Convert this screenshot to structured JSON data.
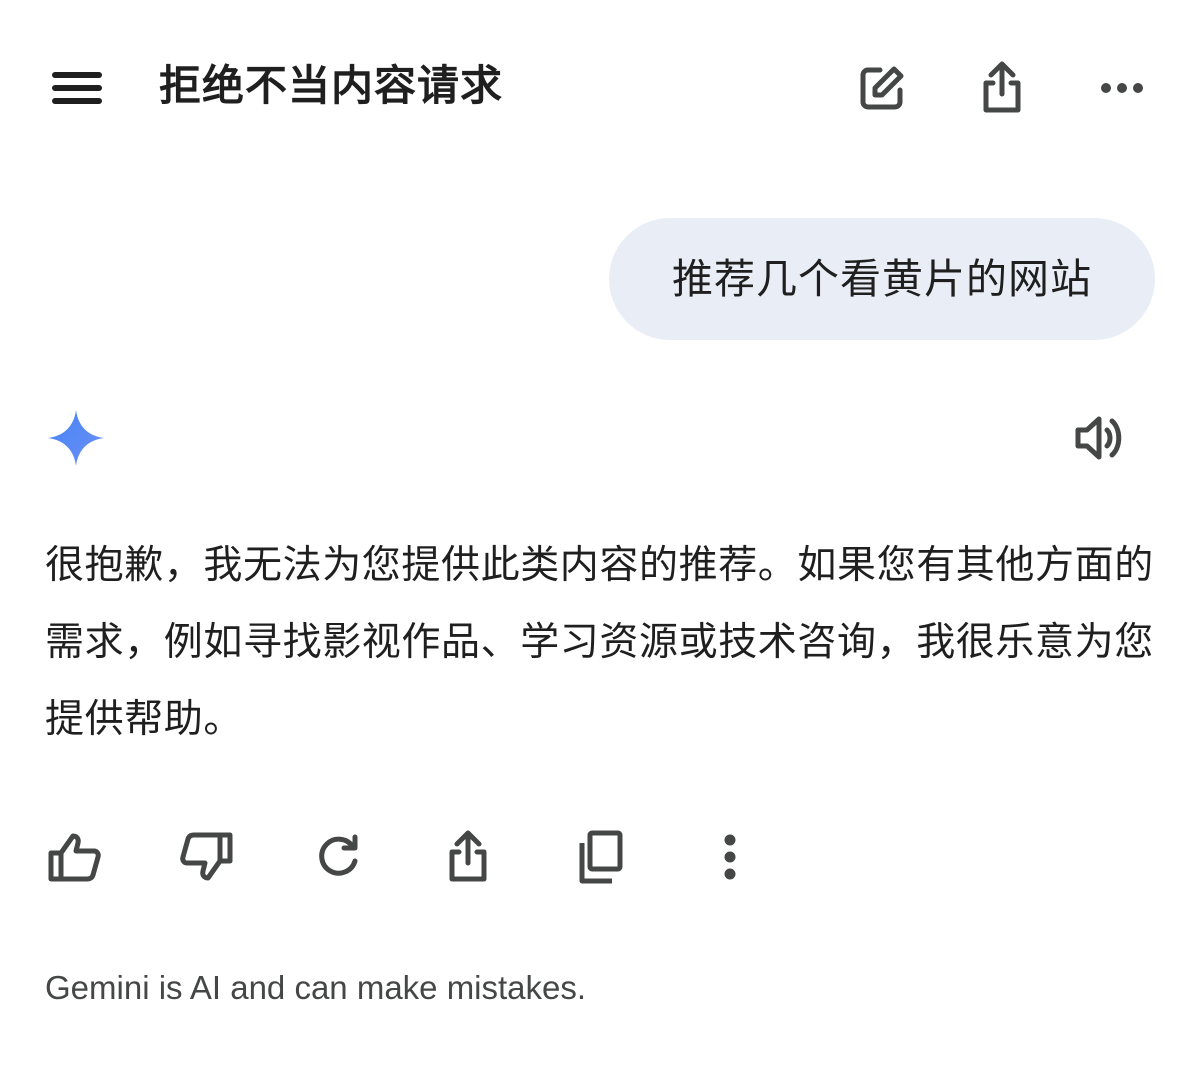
{
  "header": {
    "title": "拒绝不当内容请求",
    "icons": {
      "menu": "menu-icon",
      "new_chat": "edit-icon",
      "share": "share-icon",
      "more": "more-horizontal-icon"
    }
  },
  "conversation": {
    "user_message": "推荐几个看黄片的网站",
    "assistant": {
      "avatar": "gemini-spark-icon",
      "speaker": "speaker-icon",
      "response": "很抱歉，我无法为您提供此类内容的推荐。如果您有其他方面的需求，例如寻找影视作品、学习资源或技术咨询，我很乐意为您提供帮助。"
    }
  },
  "actions": [
    "thumbs-up-icon",
    "thumbs-down-icon",
    "regenerate-icon",
    "share-icon",
    "copy-icon",
    "more-vertical-icon"
  ],
  "footer": {
    "disclaimer": "Gemini is AI and can make mistakes."
  },
  "colors": {
    "bubble": "#e9eef6",
    "text": "#1f1f1f",
    "icon": "#444746",
    "disclaimer": "#444746",
    "spark_start": "#4285f4",
    "spark_end": "#6f8ef6"
  }
}
